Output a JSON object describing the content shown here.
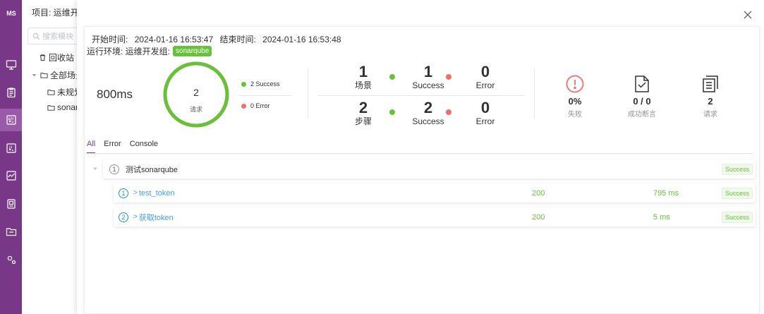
{
  "nav": {
    "logo": "MS",
    "items": [
      {
        "icon": "monitor-icon"
      },
      {
        "icon": "clipboard-icon"
      },
      {
        "icon": "api-icon"
      },
      {
        "icon": "ui-icon"
      },
      {
        "icon": "performance-icon"
      },
      {
        "icon": "report-icon"
      },
      {
        "icon": "project-folder-icon"
      },
      {
        "icon": "settings-icon"
      }
    ],
    "active_index": 2
  },
  "tree": {
    "project_label": "项目: 运维开发",
    "search_placeholder": "搜索模块",
    "recycle": "回收站",
    "all_scenarios": "全部场景",
    "unplanned": "未规划",
    "sonar": "sonarq"
  },
  "modal": {
    "start_label": "开始时间:",
    "start_time": "2024-01-16 16:53:47",
    "end_label": "结束时间:",
    "end_time": "2024-01-16 16:53:48",
    "env_label": "运行环境: 运维开发组:",
    "env_tag": "sonarqube",
    "duration": "800ms",
    "ring": {
      "count": "2",
      "label": "请求",
      "success_fraction": 1.0
    },
    "legend": {
      "success": "2 Success",
      "error": "0 Error"
    },
    "scenario": {
      "value": "1",
      "label": "场景",
      "success": "1",
      "success_label": "Success",
      "error": "0",
      "error_label": "Error"
    },
    "step": {
      "value": "2",
      "label": "步骤",
      "success": "2",
      "success_label": "Success",
      "error": "0",
      "error_label": "Error"
    },
    "summary": {
      "fail": {
        "value": "0%",
        "label": "失败"
      },
      "assert": {
        "value": "0 / 0",
        "label": "成功断言"
      },
      "request": {
        "value": "2",
        "label": "请求"
      }
    },
    "tabs": [
      "All",
      "Error",
      "Console"
    ],
    "active_tab": "All",
    "scenario_row": {
      "index": "1",
      "name": "测试sonarqube",
      "status": "Success"
    },
    "requests": [
      {
        "index": "1",
        "name": "test_token",
        "code": "200",
        "time": "795 ms",
        "status": "Success"
      },
      {
        "index": "2",
        "name": "获取token",
        "code": "200",
        "time": "5 ms",
        "status": "Success"
      }
    ],
    "colors": {
      "success": "#67c23a",
      "error": "#f56c6c",
      "brand": "#783887",
      "link": "#409eff"
    }
  }
}
